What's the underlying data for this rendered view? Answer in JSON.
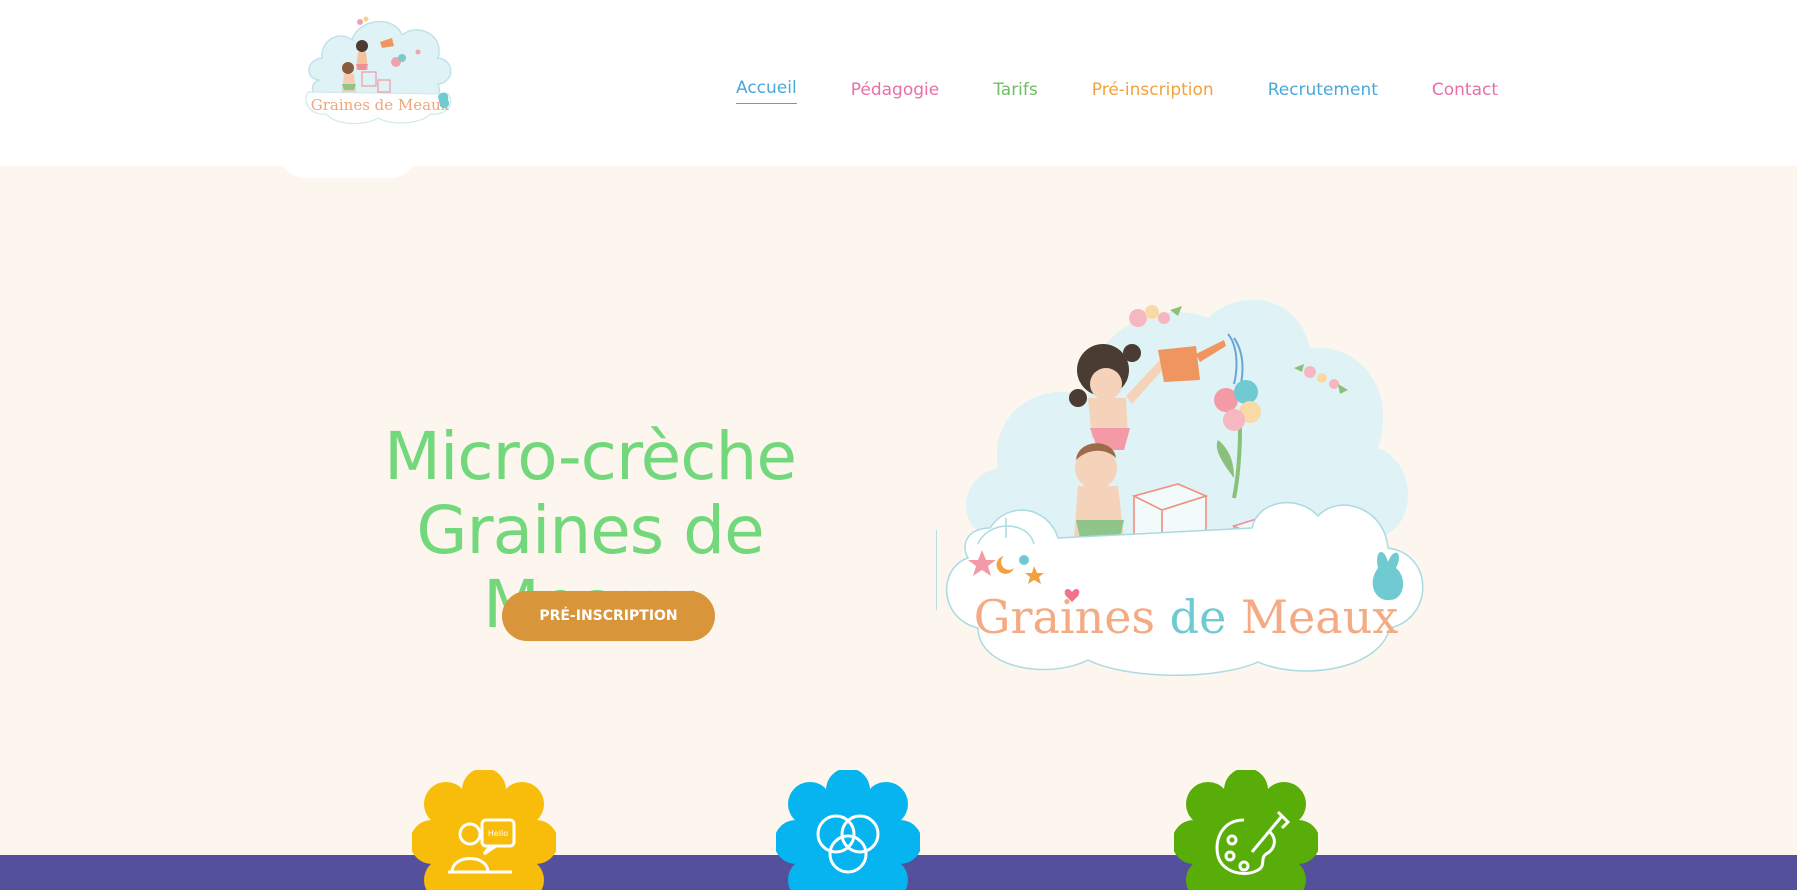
{
  "brand": {
    "logo_text": "Graines de Meaux",
    "colors": {
      "green": "#73d87c",
      "orange": "#d8953a",
      "blue": "#4aa8d8",
      "pink": "#e86fa7",
      "band": "#55509b"
    }
  },
  "nav": {
    "items": [
      {
        "label": "Accueil",
        "color": "#4aa8d8"
      },
      {
        "label": "Pédagogie",
        "color": "#e86fa7"
      },
      {
        "label": "Tarifs",
        "color": "#6cc062"
      },
      {
        "label": "Pré-inscription",
        "color": "#f2a23c"
      },
      {
        "label": "Recrutement",
        "color": "#4aa8d8"
      },
      {
        "label": "Contact",
        "color": "#e86fa7"
      }
    ]
  },
  "hero": {
    "title_line1": "Micro-crèche",
    "title_line2": "Graines de Meaux",
    "cta_label": "PRÉ-INSCRIPTION"
  },
  "features": {
    "badges": [
      {
        "icon": "speech-bubbles-icon",
        "color": "#f7bd0a",
        "bubble_text": "Hello"
      },
      {
        "icon": "circles-icon",
        "color": "#06b5ef"
      },
      {
        "icon": "palette-icon",
        "color": "#58ad09"
      }
    ]
  }
}
